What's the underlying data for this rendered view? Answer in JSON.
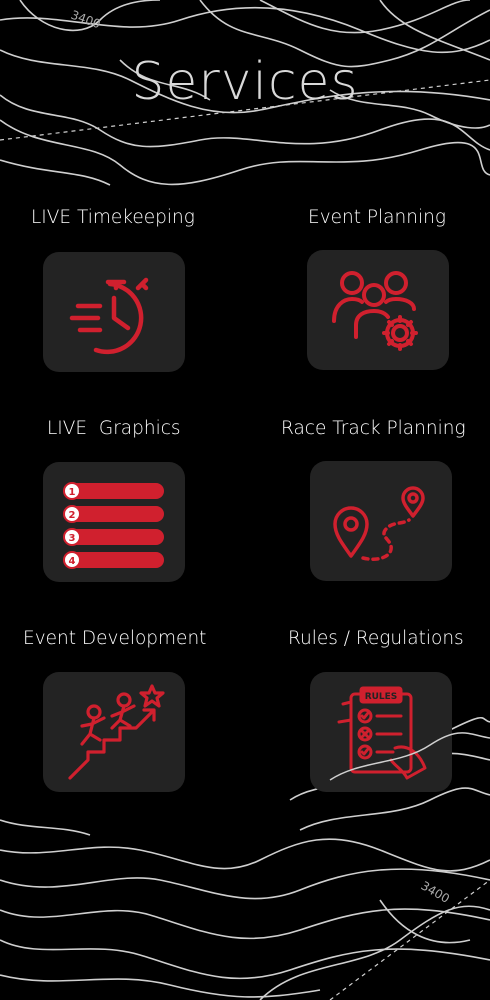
{
  "page": {
    "title": "Services"
  },
  "colors": {
    "accent": "#d0202e",
    "tile": "#232323",
    "background": "#000000",
    "contour": "#cfcfcf"
  },
  "services": [
    {
      "label": "LIVE Timekeeping",
      "icon": "stopwatch-icon"
    },
    {
      "label": "Event Planning",
      "icon": "team-gear-icon"
    },
    {
      "label": "LIVE  Graphics",
      "icon": "numbered-list-icon"
    },
    {
      "label": "Race Track Planning",
      "icon": "route-pins-icon"
    },
    {
      "label": "Event Development",
      "icon": "climbing-stairs-icon"
    },
    {
      "label": "Rules / Regulations",
      "icon": "rules-clipboard-icon"
    }
  ],
  "list_numbers": [
    "1",
    "2",
    "3",
    "4"
  ],
  "rules_sign": "RULES",
  "contour_labels": [
    "3400",
    "3400"
  ]
}
